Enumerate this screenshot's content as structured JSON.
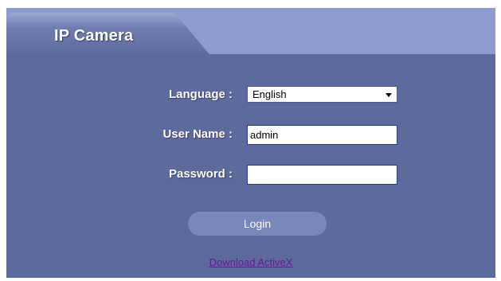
{
  "header": {
    "title": "IP Camera"
  },
  "form": {
    "language_label": "Language :",
    "language_value": "English",
    "username_label": "User Name :",
    "username_value": "admin",
    "password_label": "Password :",
    "password_value": ""
  },
  "actions": {
    "login_label": "Login"
  },
  "footer": {
    "download_label": "Download ActiveX"
  },
  "colors": {
    "panel_bg": "#5d6a9c",
    "header_bg": "#8d9ccc",
    "button_bg": "#7a87ba",
    "link": "#6b1596"
  }
}
